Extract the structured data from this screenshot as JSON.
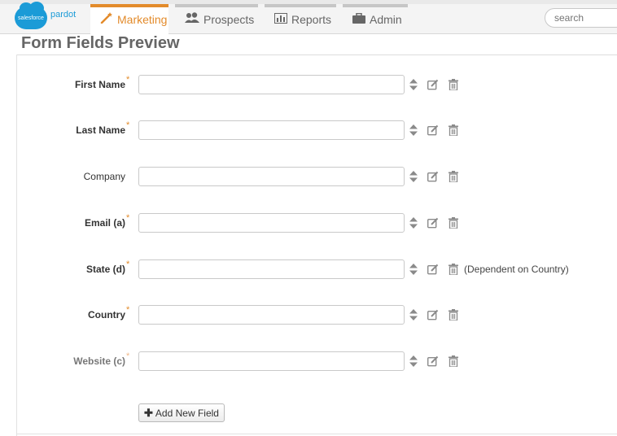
{
  "nav": {
    "logo_cloud_text": "salesforce",
    "logo_text": "pardot",
    "tabs": [
      {
        "label": "Marketing",
        "icon": "magic-wand-icon",
        "active": true
      },
      {
        "label": "Prospects",
        "icon": "people-icon",
        "active": false
      },
      {
        "label": "Reports",
        "icon": "bar-chart-icon",
        "active": false
      },
      {
        "label": "Admin",
        "icon": "briefcase-icon",
        "active": false
      }
    ],
    "search_placeholder": "search"
  },
  "page": {
    "title": "Form Fields Preview"
  },
  "fields": [
    {
      "label": "First Name",
      "required": true,
      "note": ""
    },
    {
      "label": "Last Name",
      "required": true,
      "note": ""
    },
    {
      "label": "Company",
      "required": false,
      "note": ""
    },
    {
      "label": "Email (a)",
      "required": true,
      "note": ""
    },
    {
      "label": "State (d)",
      "required": true,
      "note": "(Dependent on Country)"
    },
    {
      "label": "Country",
      "required": true,
      "note": ""
    },
    {
      "label": "Website (c)",
      "required": true,
      "note": ""
    }
  ],
  "required_marker": "*",
  "add_button": {
    "icon": "plus-icon",
    "label": "Add New Field"
  },
  "colors": {
    "accent": "#e38b2b",
    "brand": "#1b9bd7"
  }
}
